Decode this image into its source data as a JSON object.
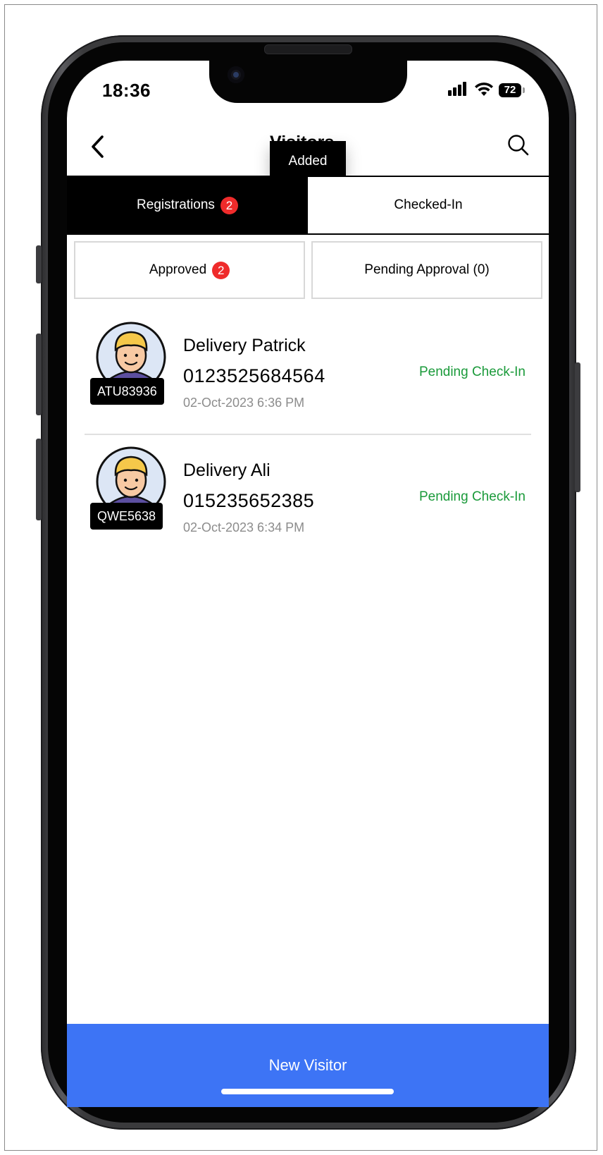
{
  "status_bar": {
    "time": "18:36",
    "battery": "72"
  },
  "nav": {
    "title": "Visitors",
    "tooltip": "Added"
  },
  "tabs": [
    {
      "label": "Registrations",
      "badge": "2"
    },
    {
      "label": "Checked-In"
    }
  ],
  "filters": [
    {
      "label": "Approved",
      "badge": "2"
    },
    {
      "label": "Pending Approval (0)"
    }
  ],
  "visitors": [
    {
      "id": "ATU83936",
      "name": "Delivery Patrick",
      "phone": "0123525684564",
      "datetime": "02-Oct-2023 6:36 PM",
      "status": "Pending Check-In"
    },
    {
      "id": "QWE5638",
      "name": "Delivery Ali",
      "phone": "015235652385",
      "datetime": "02-Oct-2023 6:34 PM",
      "status": "Pending Check-In"
    }
  ],
  "footer": {
    "new_visitor_label": "New Visitor"
  },
  "colors": {
    "accent": "#3d74f5",
    "badge": "#ef2b2b",
    "status_green": "#1a9a3a"
  }
}
